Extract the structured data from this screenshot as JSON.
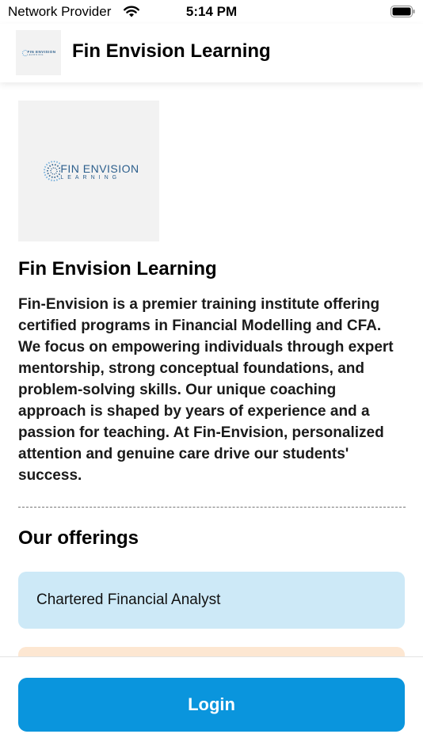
{
  "status_bar": {
    "carrier": "Network Provider",
    "time": "5:14 PM",
    "wifi_icon": "wifi-icon",
    "battery_icon": "battery-icon"
  },
  "header": {
    "title": "Fin Envision Learning",
    "logo_brand": "FIN ENVISION",
    "logo_sub": "LEARNING"
  },
  "hero": {
    "logo_brand": "FIN ENVISION",
    "logo_sub": "LEARNING"
  },
  "about": {
    "title": "Fin Envision Learning",
    "description": "Fin-Envision is a premier training institute offering certified programs in Financial Modelling and CFA. We focus on empowering individuals through expert mentorship, strong conceptual foundations, and problem-solving skills. Our unique coaching approach is shaped by years of experience and a passion for teaching. At Fin-Envision, personalized attention and genuine care drive our students' success."
  },
  "offerings": {
    "heading": "Our offerings",
    "items": [
      {
        "label": "Chartered Financial Analyst",
        "color": "#cde9f7"
      },
      {
        "label": "",
        "color": "#fde7d2"
      }
    ]
  },
  "footer": {
    "login_label": "Login",
    "accent_color": "#0a95dd"
  }
}
